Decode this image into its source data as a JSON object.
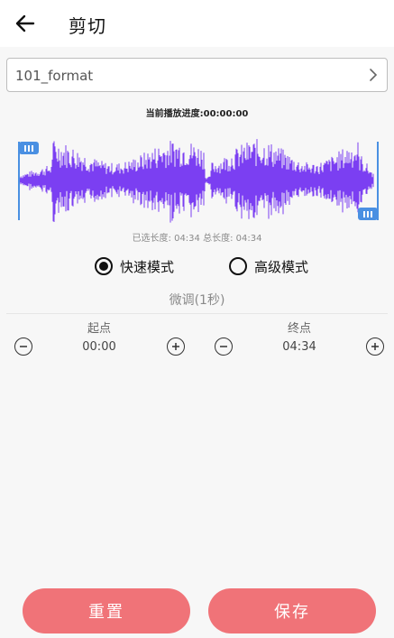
{
  "header": {
    "title": "剪切",
    "back_icon": "arrow-left-icon"
  },
  "file": {
    "name": "101_format",
    "chevron_icon": "chevron-right-icon"
  },
  "playback": {
    "progress_text": "当前播放进度:00:00:00"
  },
  "waveform": {
    "color": "#7b3ff2",
    "handle_color": "#4a90e2"
  },
  "length": {
    "text": "已选长度: 04:34 总长度: 04:34"
  },
  "modes": {
    "fast_label": "快速模式",
    "advanced_label": "高级模式",
    "selected": "fast"
  },
  "fine_tune": {
    "label": "微调(1秒)",
    "start_label": "起点",
    "start_value": "00:00",
    "end_label": "终点",
    "end_value": "04:34"
  },
  "actions": {
    "reset_label": "重置",
    "save_label": "保存",
    "button_color": "#f07378"
  }
}
